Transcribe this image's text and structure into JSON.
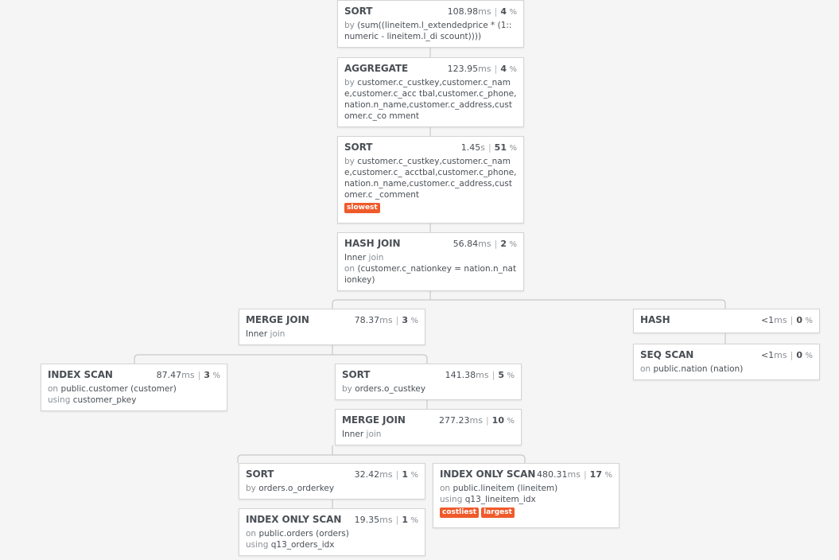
{
  "nodes": [
    {
      "id": "sort1",
      "type": "SORT",
      "time": "108.98",
      "unit": "ms",
      "pct": "4",
      "pct_sym": "%",
      "lines": [
        {
          "kw": "by",
          "text": "(sum((lineitem.l_extendedprice * (1::numeric - lineitem.l_di scount))))"
        }
      ],
      "badges": []
    },
    {
      "id": "agg",
      "type": "AGGREGATE",
      "time": "123.95",
      "unit": "ms",
      "pct": "4",
      "pct_sym": "%",
      "lines": [
        {
          "kw": "by",
          "text": "customer.c_custkey,customer.c_name,customer.c_acc tbal,customer.c_phone,nation.n_name,customer.c_address,customer.c_co mment"
        }
      ],
      "badges": []
    },
    {
      "id": "sort2",
      "type": "SORT",
      "time": "1.45",
      "unit": "s",
      "pct": "51",
      "pct_sym": "%",
      "lines": [
        {
          "kw": "by",
          "text": "customer.c_custkey,customer.c_name,customer.c_ acctbal,customer.c_phone,nation.n_name,customer.c_address,customer.c _comment"
        }
      ],
      "badges": [
        "slowest"
      ]
    },
    {
      "id": "hashjoin",
      "type": "HASH JOIN",
      "time": "56.84",
      "unit": "ms",
      "pct": "2",
      "pct_sym": "%",
      "lines": [
        {
          "kw": "",
          "text": "Inner",
          "kw2": "join"
        },
        {
          "kw": "on",
          "text": "(customer.c_nationkey = nation.n_nationkey)"
        }
      ],
      "badges": []
    },
    {
      "id": "mergejoin1",
      "type": "MERGE JOIN",
      "time": "78.37",
      "unit": "ms",
      "pct": "3",
      "pct_sym": "%",
      "lines": [
        {
          "kw": "",
          "text": "Inner",
          "kw2": "join"
        }
      ],
      "badges": []
    },
    {
      "id": "hash",
      "type": "HASH",
      "time": "<1",
      "unit": "ms",
      "pct": "0",
      "pct_sym": "%",
      "lines": [],
      "badges": []
    },
    {
      "id": "seqscan",
      "type": "SEQ SCAN",
      "time": "<1",
      "unit": "ms",
      "pct": "0",
      "pct_sym": "%",
      "lines": [
        {
          "kw": "on",
          "text": "public.nation (nation)"
        }
      ],
      "badges": []
    },
    {
      "id": "indexscan",
      "type": "INDEX SCAN",
      "time": "87.47",
      "unit": "ms",
      "pct": "3",
      "pct_sym": "%",
      "lines": [
        {
          "kw": "on",
          "text": "public.customer (customer)"
        },
        {
          "kw": "using",
          "text": "customer_pkey"
        }
      ],
      "badges": []
    },
    {
      "id": "sort3",
      "type": "SORT",
      "time": "141.38",
      "unit": "ms",
      "pct": "5",
      "pct_sym": "%",
      "lines": [
        {
          "kw": "by",
          "text": "orders.o_custkey"
        }
      ],
      "badges": []
    },
    {
      "id": "mergejoin2",
      "type": "MERGE JOIN",
      "time": "277.23",
      "unit": "ms",
      "pct": "10",
      "pct_sym": "%",
      "lines": [
        {
          "kw": "",
          "text": "Inner",
          "kw2": "join"
        }
      ],
      "badges": []
    },
    {
      "id": "sort4",
      "type": "SORT",
      "time": "32.42",
      "unit": "ms",
      "pct": "1",
      "pct_sym": "%",
      "lines": [
        {
          "kw": "by",
          "text": "orders.o_orderkey"
        }
      ],
      "badges": []
    },
    {
      "id": "idxonly1",
      "type": "INDEX ONLY SCAN",
      "time": "480.31",
      "unit": "ms",
      "pct": "17",
      "pct_sym": "%",
      "lines": [
        {
          "kw": "on",
          "text": "public.lineitem (lineitem)"
        },
        {
          "kw": "using",
          "text": "q13_lineitem_idx"
        }
      ],
      "badges": [
        "costliest",
        "largest"
      ]
    },
    {
      "id": "idxonly2",
      "type": "INDEX ONLY SCAN",
      "time": "19.35",
      "unit": "ms",
      "pct": "1",
      "pct_sym": "%",
      "lines": [
        {
          "kw": "on",
          "text": "public.orders (orders)"
        },
        {
          "kw": "using",
          "text": "q13_orders_idx"
        }
      ],
      "badges": []
    }
  ]
}
